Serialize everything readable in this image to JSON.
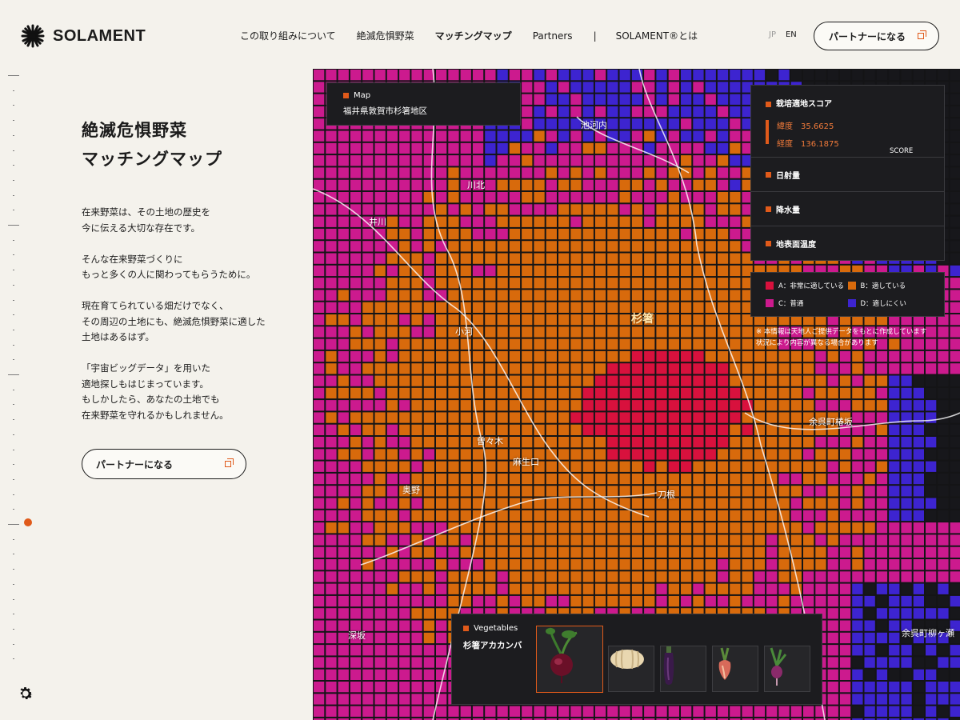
{
  "brand": {
    "name": "SOLAMENT"
  },
  "nav": {
    "items": [
      "この取り組みについて",
      "絶滅危惧野菜",
      "マッチングマップ",
      "Partners",
      "|",
      "SOLAMENT®とは"
    ],
    "active": "マッチングマップ"
  },
  "lang": {
    "jp": "JP",
    "en": "EN"
  },
  "partner_button": "パートナーになる",
  "page": {
    "title_line1": "絶滅危惧野菜",
    "title_line2": "マッチングマップ",
    "paragraphs": [
      "在来野菜は、その土地の歴史を\n今に伝える大切な存在です。",
      "そんな在来野菜づくりに\nもっと多くの人に関わってもらうために。",
      "現在育てられている畑だけでなく、\nその周辺の土地にも、絶滅危惧野菜に適した\n土地はあるはず。",
      "「宇宙ビッグデータ」を用いた\n適地探しもはじまっています。\nもしかしたら、あなたの土地でも\n在来野菜を守れるかもしれません。"
    ]
  },
  "map": {
    "panel_label": "Map",
    "location": "福井県敦賀市杉箸地区",
    "places": {
      "ikawachi": "池河内",
      "kawakita": "川北",
      "ikawa": "井川",
      "ogawa": "小河",
      "sugihashi": "杉箸",
      "yogo_tsubakisaka": "余呉町椿坂",
      "sodegi": "曽々木",
      "asoguchi": "麻生口",
      "okuno": "奥野",
      "tone": "刀根",
      "fukasaka": "深坂",
      "yogo_yanagase": "余呉町柳ヶ瀬"
    },
    "colors": {
      "A": "#d8113d",
      "B": "#d86a0c",
      "C": "#cc1a8e",
      "D": "#3d24d0",
      "none": "#17171b",
      "grid": "#141416"
    }
  },
  "score": {
    "title": "栽培適地スコア",
    "lat_label": "緯度",
    "lat_value": "35.6625",
    "lng_label": "経度",
    "lng_value": "136.1875",
    "score_label": "SCORE",
    "rows": [
      "日射量",
      "降水量",
      "地表面温度"
    ]
  },
  "legend": [
    {
      "label": "A：非常に適している",
      "color": "#d8113d"
    },
    {
      "label": "B：適している",
      "color": "#d86a0c"
    },
    {
      "label": "C：普通",
      "color": "#cc1a8e"
    },
    {
      "label": "D：適しにくい",
      "color": "#3d24d0"
    }
  ],
  "note": "※ 本情報は天地人ご提供データをもとに作成しています\n状況により内容が異なる場合があります",
  "vegetables": {
    "label": "Vegetables",
    "selected": "杉箸アカカンバ",
    "items": [
      "turnip-red-icon",
      "pumpkin-icon",
      "eggplant-icon",
      "turnip-pink-icon",
      "radish-icon"
    ]
  }
}
